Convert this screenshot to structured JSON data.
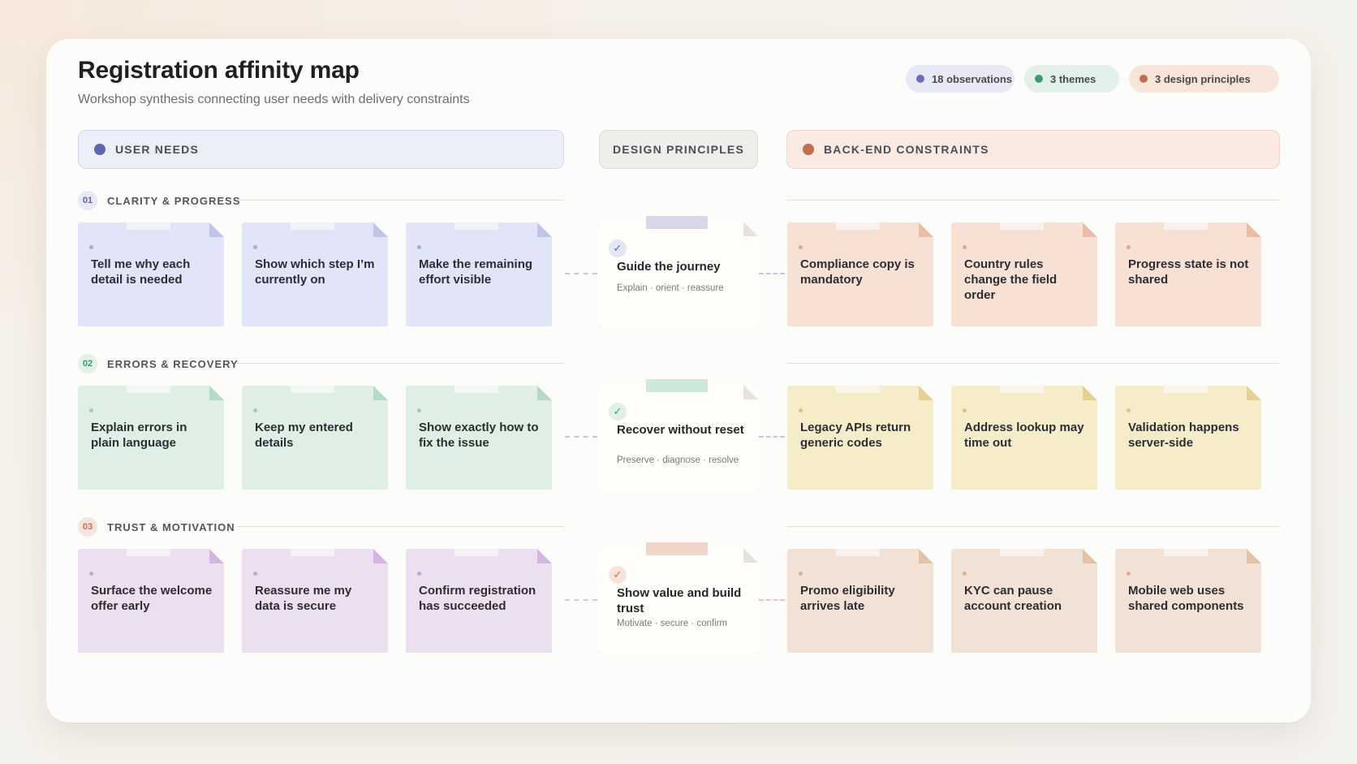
{
  "header": {
    "title": "Registration affinity map",
    "subtitle": "Workshop synthesis connecting user needs with delivery constraints"
  },
  "stats": [
    {
      "label": "18 observations",
      "dot_color": "#6b6fb3",
      "bg_color": "#e9e8f6"
    },
    {
      "label": "3 themes",
      "dot_color": "#3f9a72",
      "bg_color": "#e2f1ea"
    },
    {
      "label": "3 design principles",
      "dot_color": "#c0714e",
      "bg_color": "#f8e5da"
    }
  ],
  "lanes": {
    "user_needs": {
      "label": "USER NEEDS",
      "dot_color": "#5d66b1"
    },
    "design_principles": {
      "label": "DESIGN PRINCIPLES"
    },
    "constraints": {
      "label": "BACK-END CONSTRAINTS",
      "dot_color": "#c0704c"
    }
  },
  "themes": [
    {
      "number": "01",
      "label": "CLARITY & PROGRESS",
      "user_needs": [
        "Tell me why each detail is needed",
        "Show which step I’m currently on",
        "Make the remaining effort visible"
      ],
      "principle": {
        "title": "Guide the journey",
        "subtitle": "Explain · orient · reassure",
        "icon": "check-icon"
      },
      "constraints": [
        "Compliance copy is mandatory",
        "Country rules change the field order",
        "Progress state is not shared"
      ]
    },
    {
      "number": "02",
      "label": "ERRORS & RECOVERY",
      "user_needs": [
        "Explain errors in plain language",
        "Keep my entered details",
        "Show exactly how to fix the issue"
      ],
      "principle": {
        "title": "Recover without reset",
        "subtitle": "Preserve · diagnose · resolve",
        "icon": "check-icon"
      },
      "constraints": [
        "Legacy APIs return generic codes",
        "Address lookup may time out",
        "Validation happens server-side"
      ]
    },
    {
      "number": "03",
      "label": "TRUST & MOTIVATION",
      "user_needs": [
        "Surface the welcome offer early",
        "Reassure me my data is secure",
        "Confirm registration has succeeded"
      ],
      "principle": {
        "title": "Show value and build trust",
        "subtitle": "Motivate · secure · confirm",
        "icon": "check-icon"
      },
      "constraints": [
        "Promo eligibility arrives late",
        "KYC can pause account creation",
        "Mobile web uses shared components"
      ]
    }
  ]
}
